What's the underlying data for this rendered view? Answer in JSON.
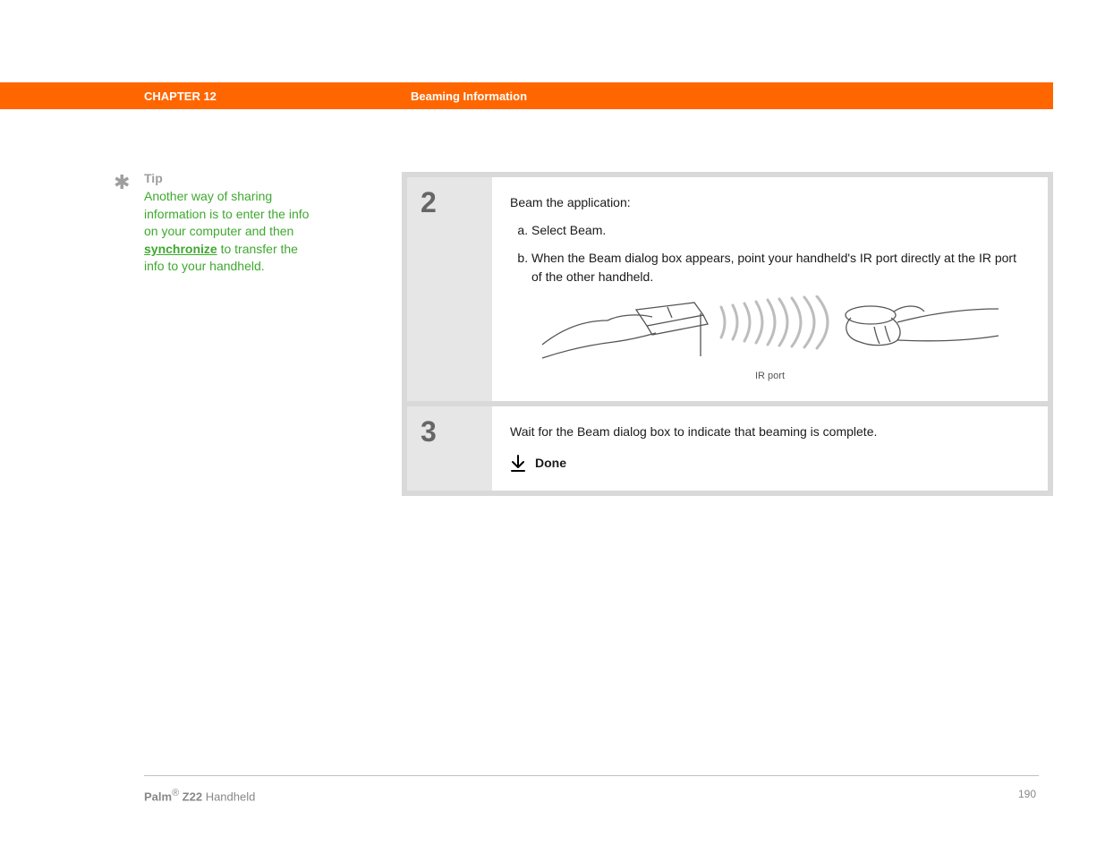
{
  "header": {
    "chapter": "CHAPTER 12",
    "title": "Beaming Information"
  },
  "tip": {
    "label": "Tip",
    "before_link": "Another way of sharing information is to enter the info on your computer and then ",
    "link_text": "synchronize",
    "after_link": " to transfer the info to your handheld."
  },
  "steps": {
    "s2": {
      "number": "2",
      "lead": "Beam the application:",
      "a": "Select Beam.",
      "b": "When the Beam dialog box appears, point your handheld's IR port directly at the IR port of the other handheld.",
      "illustration_label": "IR port"
    },
    "s3": {
      "number": "3",
      "body": "Wait for the Beam dialog box to indicate that beaming is complete.",
      "done_label": "Done"
    }
  },
  "footer": {
    "brand_bold": "Palm",
    "brand_reg": "®",
    "model_bold": " Z22",
    "model_rest": " Handheld",
    "page_number": "190"
  }
}
